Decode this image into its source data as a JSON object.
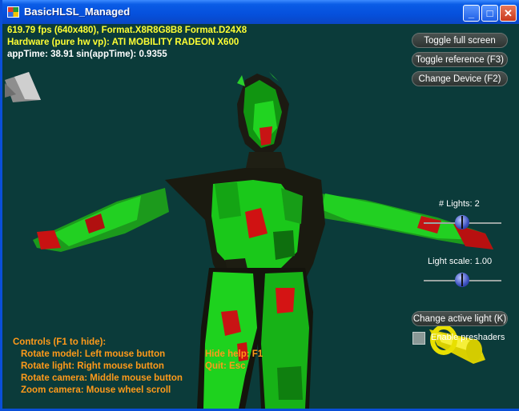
{
  "window": {
    "title": "BasicHLSL_Managed",
    "minimize_glyph": "_",
    "maximize_glyph": "□",
    "close_glyph": "✕"
  },
  "stats": {
    "line1": "619.79 fps (640x480), Format.X8R8G8B8 Format.D24X8",
    "line2": "Hardware (pure hw vp): ATI MOBILITY RADEON X600",
    "line3": "appTime: 38.91 sin(appTime): 0.9355"
  },
  "buttons": {
    "toggle_full_screen": "Toggle full screen",
    "toggle_reference": "Toggle reference (F3)",
    "change_device": "Change Device (F2)",
    "change_active_light": "Change active light (K)"
  },
  "sliders": {
    "lights_label": "# Lights: 2",
    "lights_fraction": 0.5,
    "light_scale_label": "Light scale: 1.00",
    "light_scale_fraction": 0.5
  },
  "checkbox": {
    "enable_preshaders_label": "Enable preshaders",
    "checked": false
  },
  "help": {
    "header": "Controls (F1 to hide):",
    "rotate_model": "Rotate model: Left mouse button",
    "rotate_light": "Rotate light: Right mouse button",
    "rotate_camera": "Rotate camera: Middle mouse button",
    "zoom_camera": "Zoom camera: Mouse wheel scroll",
    "hide_help": "Hide help: F1",
    "quit": "Quit: Esc"
  },
  "scene": {
    "background_color": "#0b3b3a",
    "model_green": "#1ee01e",
    "model_red": "#d01010",
    "light_arrow_yellow": "#e8e000",
    "light_arrow_gray": "#b8b8b8"
  }
}
